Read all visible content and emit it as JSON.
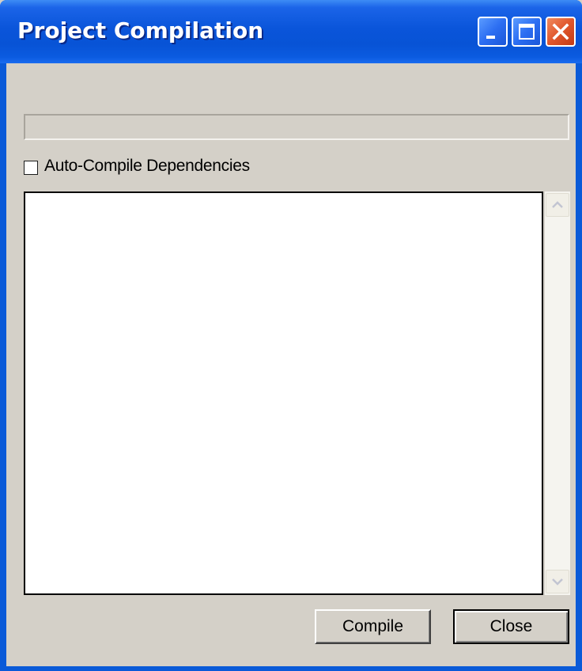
{
  "window": {
    "title": "Project Compilation"
  },
  "progress": {
    "value": 0
  },
  "auto_compile": {
    "label": "Auto-Compile Dependencies",
    "checked": false
  },
  "output_log": {
    "text": ""
  },
  "buttons": {
    "compile_label": "Compile",
    "close_label": "Close"
  },
  "icons": {
    "minimize": "minimize-icon",
    "maximize": "maximize-icon",
    "close": "close-icon",
    "scroll_up": "chevron-up-icon",
    "scroll_down": "chevron-down-icon"
  },
  "colors": {
    "titlebar": "#0a55da",
    "dialog_face": "#d4d0c8",
    "close_button": "#e0562c"
  }
}
